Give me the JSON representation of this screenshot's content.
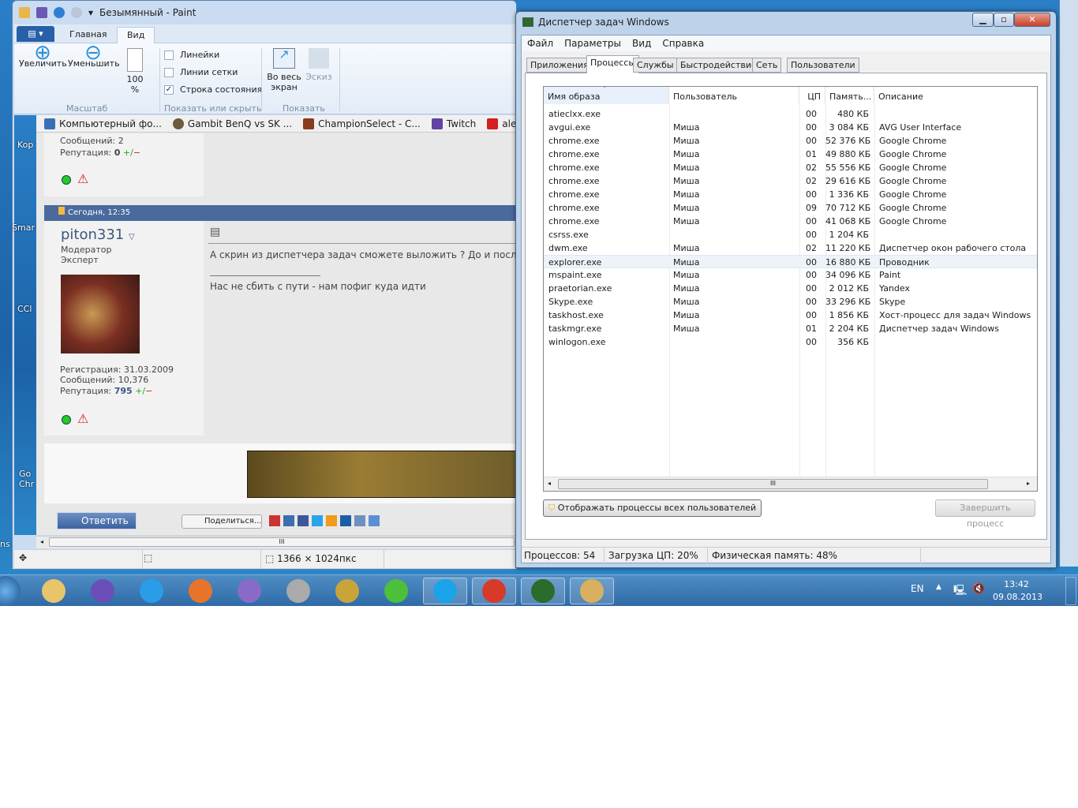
{
  "desktop": {
    "icons": [
      "Kop",
      "Smar",
      "CCl",
      "Go Chr",
      "ns"
    ]
  },
  "paint": {
    "title": "Безымянный - Paint",
    "tabs": [
      "Главная",
      "Вид"
    ],
    "ribbon": {
      "zoom_in": "Увеличить",
      "zoom_out": "Уменьшить",
      "zoom_100": "100 %",
      "group_zoom": "Масштаб",
      "rulers": "Линейки",
      "gridlines": "Линии сетки",
      "statusbar": "Строка состояния",
      "group_show": "Показать или скрыть",
      "fullscreen": "Во весь экран",
      "thumbnail": "Эскиз",
      "group_display": "Показать"
    },
    "status": {
      "size": "1366 × 1024пкс"
    }
  },
  "browser": {
    "bookmarks": [
      "Компьютерный фо...",
      "Gambit BenQ vs SK ...",
      "ChampionSelect - C...",
      "Twitch",
      "alex ich zed"
    ],
    "prev_user": {
      "messages": "Сообщений: 2",
      "reputation_label": "Репутация:",
      "reputation": "0"
    },
    "post": {
      "date": "Сегодня, 12:35",
      "username": "piton331",
      "role1": "Модератор",
      "role2": "Эксперт",
      "registration": "Регистрация: 31.03.2009",
      "messages": "Сообщений: 10,376",
      "reputation_label": "Репутация:",
      "reputation": "795",
      "text": "А скрин из диспетчера задач сможете выложить ? До и после пробл",
      "signature": "Нас не сбить с пути - нам пофиг куда идти"
    },
    "reply": "Ответить",
    "share": "Поделиться..."
  },
  "taskmgr": {
    "title": "Диспетчер задач Windows",
    "menu": [
      "Файл",
      "Параметры",
      "Вид",
      "Справка"
    ],
    "tabs": [
      "Приложения",
      "Процессы",
      "Службы",
      "Быстродействие",
      "Сеть",
      "Пользователи"
    ],
    "active_tab": 1,
    "columns": [
      "Имя образа",
      "Пользователь",
      "ЦП",
      "Память...",
      "Описание"
    ],
    "processes": [
      [
        "atieclxx.exe",
        "",
        "00",
        "480 КБ",
        ""
      ],
      [
        "avgui.exe",
        "Миша",
        "00",
        "3 084 КБ",
        "AVG User Interface"
      ],
      [
        "chrome.exe",
        "Миша",
        "00",
        "52 376 КБ",
        "Google Chrome"
      ],
      [
        "chrome.exe",
        "Миша",
        "01",
        "49 880 КБ",
        "Google Chrome"
      ],
      [
        "chrome.exe",
        "Миша",
        "02",
        "55 556 КБ",
        "Google Chrome"
      ],
      [
        "chrome.exe",
        "Миша",
        "02",
        "29 616 КБ",
        "Google Chrome"
      ],
      [
        "chrome.exe",
        "Миша",
        "00",
        "1 336 КБ",
        "Google Chrome"
      ],
      [
        "chrome.exe",
        "Миша",
        "09",
        "70 712 КБ",
        "Google Chrome"
      ],
      [
        "chrome.exe",
        "Миша",
        "00",
        "41 068 КБ",
        "Google Chrome"
      ],
      [
        "csrss.exe",
        "",
        "00",
        "1 204 КБ",
        ""
      ],
      [
        "dwm.exe",
        "Миша",
        "02",
        "11 220 КБ",
        "Диспетчер окон рабочего стола"
      ],
      [
        "explorer.exe",
        "Миша",
        "00",
        "16 880 КБ",
        "Проводник"
      ],
      [
        "mspaint.exe",
        "Миша",
        "00",
        "34 096 КБ",
        "Paint"
      ],
      [
        "praetorian.exe",
        "Миша",
        "00",
        "2 012 КБ",
        "Yandex"
      ],
      [
        "Skype.exe",
        "Миша",
        "00",
        "33 296 КБ",
        "Skype"
      ],
      [
        "taskhost.exe",
        "Миша",
        "00",
        "1 856 КБ",
        "Хост-процесс для задач Windows"
      ],
      [
        "taskmgr.exe",
        "Миша",
        "01",
        "2 204 КБ",
        "Диспетчер задач Windows"
      ],
      [
        "winlogon.exe",
        "",
        "00",
        "356 КБ",
        ""
      ]
    ],
    "selected_row": 11,
    "show_all_button": "Отображать процессы всех пользователей",
    "end_process_button": "Завершить процесс",
    "status": {
      "processes": "Процессов: 54",
      "cpu": "Загрузка ЦП: 20%",
      "memory": "Физическая память: 48%"
    }
  },
  "taskbar": {
    "lang": "EN",
    "time": "13:42",
    "date": "09.08.2013",
    "apps": [
      "explorer",
      "visual-studio",
      "internet-explorer",
      "firefox",
      "spider",
      "settings",
      "league-of-legends",
      "icq",
      "skype",
      "chrome",
      "task-manager",
      "paint"
    ]
  }
}
